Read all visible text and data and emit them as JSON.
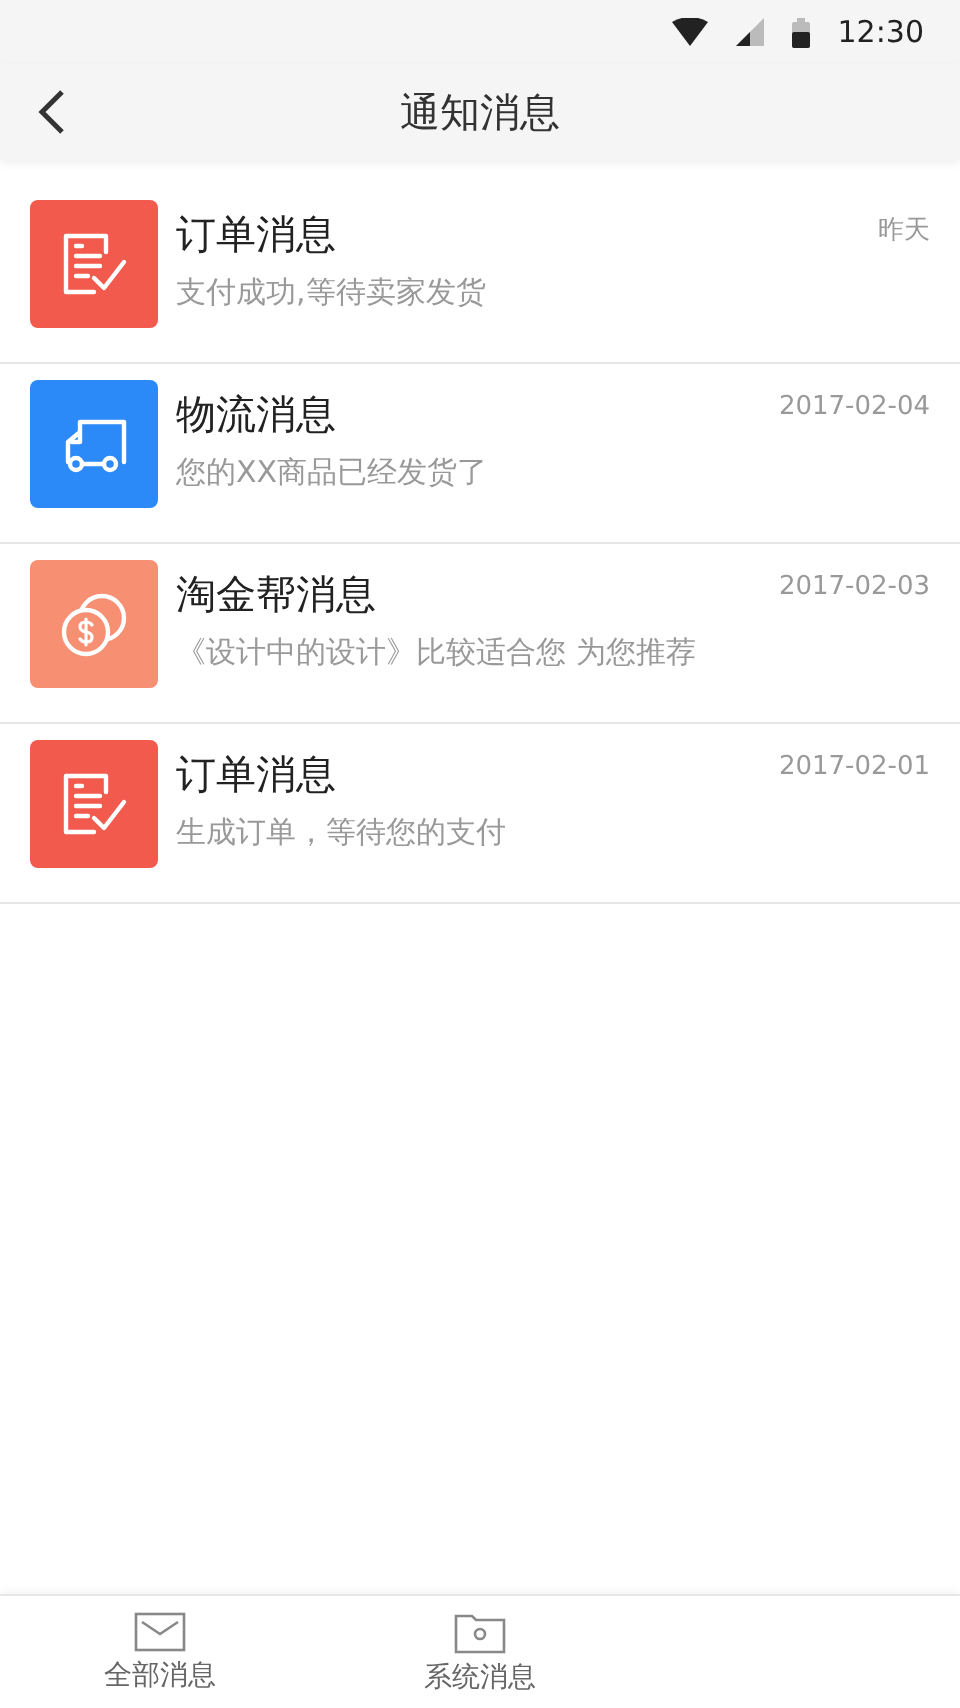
{
  "status_bar": {
    "time": "12:30"
  },
  "header": {
    "title": "通知消息"
  },
  "messages": [
    {
      "kind": "order",
      "title": "订单消息",
      "preview": "支付成功,等待卖家发货",
      "date": "昨天"
    },
    {
      "kind": "truck",
      "title": "物流消息",
      "preview": "您的XX商品已经发货了",
      "date": "2017-02-04"
    },
    {
      "kind": "coins",
      "title": "淘金帮消息",
      "preview": "《设计中的设计》比较适合您 为您推荐",
      "date": "2017-02-03"
    },
    {
      "kind": "order",
      "title": "订单消息",
      "preview": "生成订单，等待您的支付",
      "date": "2017-02-01"
    }
  ],
  "tabs": [
    {
      "kind": "mail",
      "label": "全部消息"
    },
    {
      "kind": "folder",
      "label": "系统消息"
    }
  ]
}
